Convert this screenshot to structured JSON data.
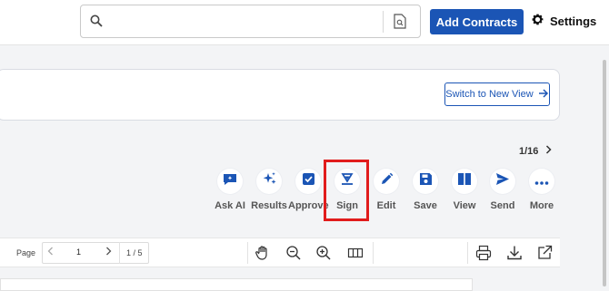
{
  "header": {
    "search_placeholder": "",
    "add_button_label": "Add Contracts",
    "settings_label": "Settings"
  },
  "banner": {
    "switch_label": "Switch to New View"
  },
  "pagination": {
    "counter": "1/16"
  },
  "toolbar": {
    "ask_ai": "Ask AI",
    "results": "Results",
    "approve": "Approve",
    "sign": "Sign",
    "edit": "Edit",
    "save": "Save",
    "view": "View",
    "send": "Send",
    "more": "More"
  },
  "pdf_toolbar": {
    "page_label": "Page",
    "page_value": "1",
    "page_total": "1 / 5"
  },
  "colors": {
    "accent": "#1b55b5",
    "highlight": "#e11c1c"
  }
}
